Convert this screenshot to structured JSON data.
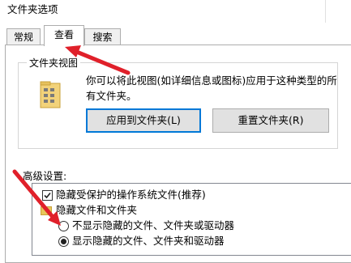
{
  "window": {
    "title": "文件夹选项"
  },
  "tabs": [
    {
      "label": "常规",
      "active": false
    },
    {
      "label": "查看",
      "active": true
    },
    {
      "label": "搜索",
      "active": false
    }
  ],
  "folder_views": {
    "title": "文件夹视图",
    "description": "你可以将此视图(如详细信息或图标)应用于这种类型的所有文件夹。",
    "apply_button": "应用到文件夹(L)",
    "reset_button": "重置文件夹(R)"
  },
  "advanced": {
    "label": "高级设置:",
    "items": [
      {
        "type": "checkbox",
        "label": "隐藏受保护的操作系统文件(推荐)",
        "checked": true
      },
      {
        "type": "folder",
        "label": "隐藏文件和文件夹"
      },
      {
        "type": "radio",
        "label": "不显示隐藏的文件、文件夹或驱动器",
        "checked": false
      },
      {
        "type": "radio",
        "label": "显示隐藏的文件、文件夹和驱动器",
        "checked": true
      }
    ]
  },
  "annotations": {
    "arrow_color": "#e0202a"
  },
  "colors": {
    "accent": "#0078d7"
  }
}
